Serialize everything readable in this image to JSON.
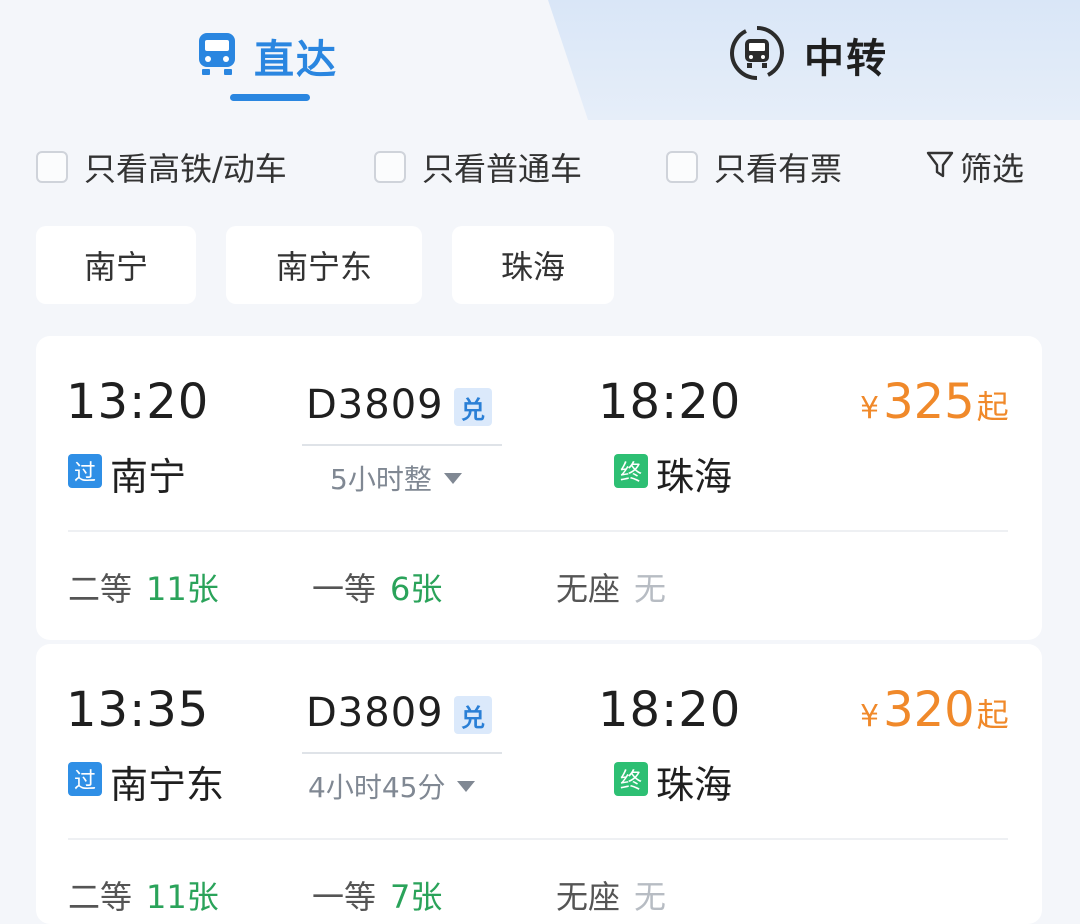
{
  "tabs": {
    "direct": "直达",
    "transfer": "中转"
  },
  "filters": {
    "high_speed_only": "只看高铁/动车",
    "normal_only": "只看普通车",
    "available_only": "只看有票",
    "filter_label": "筛选"
  },
  "stations": [
    "南宁",
    "南宁东",
    "珠海"
  ],
  "colors": {
    "accent": "#2a86e0",
    "price": "#f0892a",
    "available": "#2aa35a",
    "pass_tag": "#2f8fe6",
    "end_tag": "#2dbf73"
  },
  "trains": [
    {
      "depart_time": "13:20",
      "train_no": "D3809",
      "badge": "兑",
      "arrive_time": "18:20",
      "duration": "5小时整",
      "from_tag": "过",
      "from_station": "南宁",
      "to_tag": "终",
      "to_station": "珠海",
      "price_symbol": "¥",
      "price": "325",
      "price_suffix": "起",
      "seats": [
        {
          "name": "二等",
          "count": "11张"
        },
        {
          "name": "一等",
          "count": "6张"
        },
        {
          "name": "无座",
          "count": "无"
        }
      ]
    },
    {
      "depart_time": "13:35",
      "train_no": "D3809",
      "badge": "兑",
      "arrive_time": "18:20",
      "duration": "4小时45分",
      "from_tag": "过",
      "from_station": "南宁东",
      "to_tag": "终",
      "to_station": "珠海",
      "price_symbol": "¥",
      "price": "320",
      "price_suffix": "起",
      "seats": [
        {
          "name": "二等",
          "count": "11张"
        },
        {
          "name": "一等",
          "count": "7张"
        },
        {
          "name": "无座",
          "count": "无"
        }
      ]
    }
  ]
}
